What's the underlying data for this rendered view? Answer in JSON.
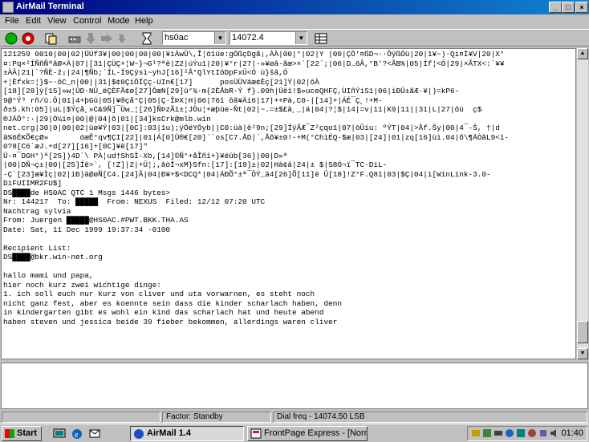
{
  "window": {
    "title": "AirMail Terminal"
  },
  "menu": [
    "File",
    "Edit",
    "View",
    "Control",
    "Mode",
    "Help"
  ],
  "toolbar": {
    "callsign": "hs0ac",
    "frequency": "14072.4"
  },
  "terminal": {
    "lines": [
      "121259 0010|00|02|ÜÚf3¥|00|00|00|00|¥ìÁwÛ\\,Î¦ö1üe:gÓßçDgã¡,ÀÀ|00|°|02|Y |00|ÇÖ'¤ßD¬··ÔÿßÓü|20|1¥~)·Qì¤Ì¥V|20|X°",
      "¤:Pq×²ÍÑñÑªâØ×À|07|[31|ÇÜÇ+¦W~}¬G¹?ªë|Z2|úÝu1|20|¥°r|27|-»¥øâ-ãæ>×`[22`;|06|D…6Â,°B'?<ÃB%|05|Íf¦<Ó|29|×ÃTX<:`¥¥",
      "±ÀÂ|21|`?ÑÈ-ž¡|24|¶Ñb;`ÍL-Í9Çÿsì~yhJ[16]²Å°QlYtIöDpFxÛ<Ó ù}šâ,Ó",
      "+¦Èfxk=¦}$~·ôC_n|00||31|$¢0ÇiÖÍÇç-UIn€[17]      posÜÜVáæ¢Èç[21]Ý|02|ôÀ",
      "[18][28]ÿ[15]»w¦ÛD·NÛ_ëÇÈFÃ¢ø[27]ÔæN[29]û°¾·m{2ÈÅbR-Ý f}.09h|Üëî!$»uceQHFÇ,ÙIñÝiS1|06|iÐÛ±ãÆ·¥|)=kP6-",
      "9@°Ý³ rñ/ü.Ô|01|4+þGû|05|¥®çå°Ç|05|Ç·ÎÞX¦H|06|76î ôã¥Äi6|17|++Pà,C0-|[14]+|ÁÉ¯Ç¸!+M-",
      "ð±5.kh:05]|uL|$Ýçå¸»C&9Ñ]¯Üw_¦[26]ÑÞzÃì±¦JÒu¦+æþüe-Ñt|02|~.=±$£â¸_|ä|04|?¦$|14|=v|11|K9|11||31|L|27|ôù  ç$",
      "®JÄÔ°:·|29|Ò¼i¤|00|@|04|õ|01|[34]ksCrk@mlb.win",
      "net.crg|30|0|00|02|üø¥Ý|03|[0C]:03|1u);ÿÓëYÓyb||C0:üà|ë²9n;[29]ÍÿÃÆ¯Z²çqo1|07|òÛiu: ºÝT|04|>Åf.Šy|00|4¯-Š, †|d",
      "ä%6ÉKÕ€çØ»       óæÊ°qv¶ÇI[22]|01|Á[0]Ü®€[20]``os[C7.ÅD|`,Åõ¥±0!-+M(°ChìÉQ-$æ|03|[24]|01|zq[16]ùì.04|õ\\¶ÄÒãL9<î-",
      "0?8[C6`æJ.+d[27][16]+[0C]¥ë[17]\"",
      "Ü-¤¯DGH°)ª[25])4D`\\ PÀ¦ud†ShSÌ-Xb,[14]©Ñ°+åÎñî+}¥éûb[36]|00|D»ª",
      "|00|DÑ¬ç±|00|[25]Íê>`, [!Z]|2|+Û¦;,âòÏ¬xM}Sfn:[17]:[19]±|02|Hà¢ä|24|± $|S8Ó¬ï¯TC·DiL-",
      "-Ç`[23]æ¥Ìç|02|iÐ)ä@øÑ[C4.[24]Â|04|Ð¥+$<DCQ*|04|ÄÐÕ°±ª¯ÔÝ_ä4[26]Õ[11]è Û[18]!Z°F.Q8î|03|$Ç|04|ì[WinLink-3.0-",
      "DiFUIIMR2FU$]",
      "DS████de HS0AC QTC 1 Msgs 1446 bytes>",
      "Nr: 144217  To: █████  From: NEXUS  Filed: 12/12 07:20 UTC",
      "Nachtrag sylvia",
      "From: Juergen █████@HS0AC.#PWT.BKK.THA.AS",
      "Date: Sat, 11 Dec 1999 19:37:34 -0100",
      "",
      "Recipient List:",
      "DS████@bkr.win-net.org",
      "",
      "hallo mami und papa,",
      "hier noch kurz zwei wichtige dinge:",
      "1. ich soll euch nur kurz von cliver und uta vorwarnen, es steht noch",
      "nicht ganz fest, aber es koennte sein dass die kinder scharlach haben, denn",
      "in kindergarten gibt es wohl ein kind das scharlach hat und heute abend",
      "haben steven und jessica beide 39 fieber bekommen, allerdings waren cliver"
    ]
  },
  "status": {
    "left": "",
    "middle": "Factor: Standby",
    "right": "Dial freq - 14074.50 LSB"
  },
  "taskbar": {
    "start": "Start",
    "tasks": [
      "AirMail 1.4",
      "FrontPage Express - [Norm..."
    ],
    "clock": "01:40"
  }
}
